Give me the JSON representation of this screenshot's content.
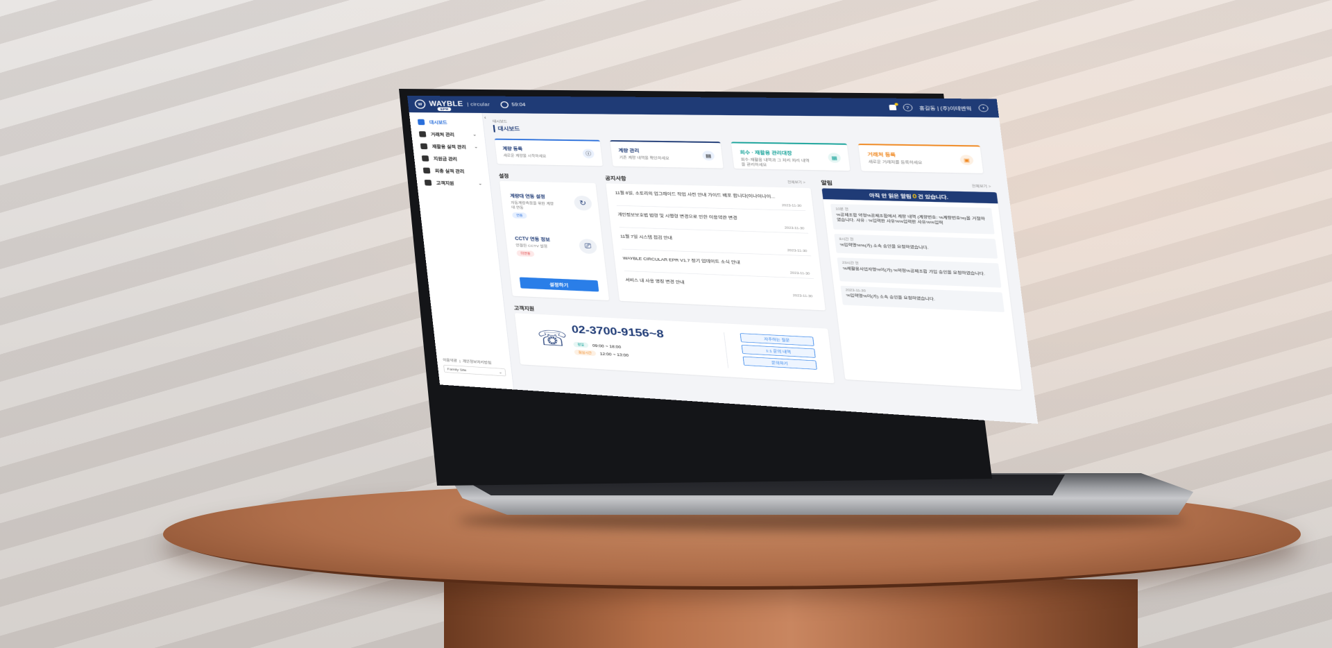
{
  "header": {
    "brand": "WAYBLE",
    "sub_brand": "| circular",
    "tag": "EPR",
    "timer": "59:04",
    "user": "홍길동 | (주)이테엔웍"
  },
  "sidebar": {
    "items": [
      {
        "label": "대시보드",
        "active": true,
        "icon": "dashboard-icon"
      },
      {
        "label": "거래처 관리",
        "has_arrow": true,
        "icon": "partner-icon"
      },
      {
        "label": "재활용 실적 관리",
        "has_arrow": true,
        "icon": "recycle-icon"
      },
      {
        "label": "지원금 관리",
        "icon": "money-icon"
      },
      {
        "label": "회총 실적 관리",
        "icon": "chart-icon"
      },
      {
        "label": "고객지원",
        "has_arrow": true,
        "icon": "support-icon"
      }
    ],
    "footer_links": [
      "이용약관",
      "개인정보처리방침"
    ],
    "family_site": "Family Site"
  },
  "main": {
    "breadcrumb": "대시보드",
    "title": "대시보드",
    "quick_cards": [
      {
        "title": "계량 등록",
        "desc": "새로운 계량을 시작하세요",
        "color": "#2a6fdb",
        "icon": "info-icon"
      },
      {
        "title": "계량 관리",
        "desc": "기존 계량 내역을 확인하세요",
        "color": "#1f3b76",
        "icon": "document-icon"
      },
      {
        "title": "회수 · 재활용 관리대장",
        "desc": "회수·재활용 내역과 그 처리 처리 내역을 관리하세요",
        "color": "#18a39a",
        "icon": "ledger-icon"
      },
      {
        "title": "거래처 등록",
        "desc": "새로운 거래처를 등록하세요",
        "color": "#f08a24",
        "icon": "register-icon"
      }
    ],
    "settings": {
      "title": "설정",
      "items": [
        {
          "title": "계량대 연동 설정",
          "desc": "자동계량측정을 위한 계량대 연동",
          "badge": "연동",
          "badge_color": "#2a6fdb"
        },
        {
          "title": "CCTV 연동 정보",
          "desc": "연결된 CCTV 설정",
          "badge": "미연동",
          "badge_color": "#e04848"
        }
      ],
      "button": "설정하기"
    },
    "notice": {
      "title": "공지사항",
      "more": "전체보기 >",
      "rows": [
        {
          "title": "11월 8일, 소토리의 업그레이드 작업 사전 안내 가이드 배포 합니다(이나이나이...",
          "date": "2023-11-30"
        },
        {
          "title": "개인정보보호법 법령 및 시행령 변경으로 인한 이용약관 변경",
          "date": "2023-11-30"
        },
        {
          "title": "11월 7일 시스템 점검 안내",
          "date": "2023-11-30"
        },
        {
          "title": "WAYBLE CIRCULAR EPR V1.7 정기 업데이트 소식 안내",
          "date": "2023-11-30"
        },
        {
          "title": "서비스 내 사용 명칭 변경 안내",
          "date": "2023-11-30"
        }
      ]
    },
    "alerts": {
      "title": "알림",
      "more": "전체보기 >",
      "head_pre": "아직 안 읽은 알림",
      "count": "0",
      "head_post": "건 있습니다.",
      "items": [
        {
          "time": "10분 전",
          "text": "%공제조합 약정%공제조합에서 계량 내역 (계량번호: %계량번호%)을 거절하였습니다. 사유 : %입력한 사유%%입력한 사유%%입력"
        },
        {
          "time": "8시간 전",
          "text": "%입력명%%(가) 소속 승인을 요청하였습니다."
        },
        {
          "time": "23시간 전",
          "text": "%재활용사업자명%이(가) %약정%공제조합 가입 승인을 요청하였습니다."
        },
        {
          "time": "2023-11-30",
          "text": "%입력명%이(가) 소속 승인을 요청하였습니다."
        }
      ]
    },
    "support": {
      "title": "고객지원",
      "phone": "02-3700-9156~8",
      "hours": [
        {
          "label": "평일",
          "time": "09:00 ~ 18:00",
          "color": "#18a39a"
        },
        {
          "label": "점심시간",
          "time": "12:00 ~ 13:00",
          "color": "#f08a24"
        }
      ],
      "buttons": [
        "자주하는 질문",
        "1:1 문의 내역",
        "문의하기"
      ]
    }
  }
}
